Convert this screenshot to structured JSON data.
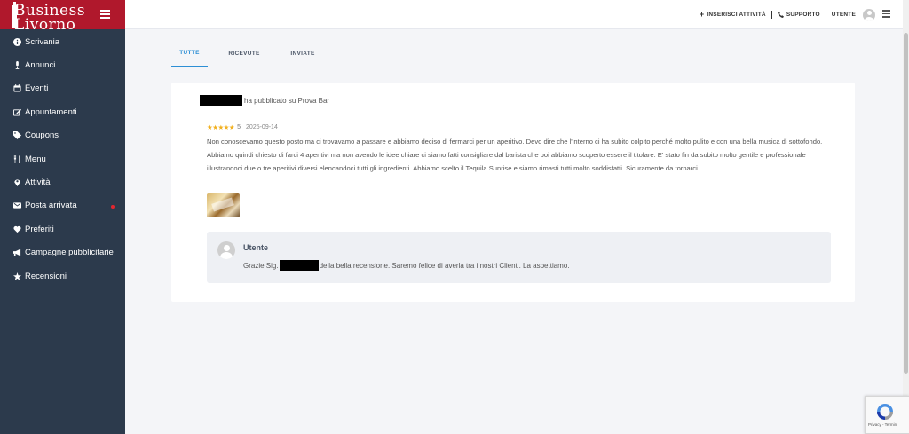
{
  "brand": {
    "line1": "Business",
    "line2": "Livorno"
  },
  "sidebar": {
    "items": [
      {
        "label": "Scrivania",
        "icon": "info-icon"
      },
      {
        "label": "Annunci",
        "icon": "microphone-icon"
      },
      {
        "label": "Eventi",
        "icon": "calendar-icon"
      },
      {
        "label": "Appuntamenti",
        "icon": "edit-icon"
      },
      {
        "label": "Coupons",
        "icon": "tags-icon"
      },
      {
        "label": "Menu",
        "icon": "utensils-icon"
      },
      {
        "label": "Attività",
        "icon": "map-marker-icon"
      },
      {
        "label": "Posta arrivata",
        "icon": "envelope-icon",
        "badge": true
      },
      {
        "label": "Preferiti",
        "icon": "heart-icon"
      },
      {
        "label": "Campagne pubblicitarie",
        "icon": "bullhorn-icon"
      },
      {
        "label": "Recensioni",
        "icon": "star-icon"
      }
    ]
  },
  "topbar": {
    "add_listing": "INSERISCI ATTIVITÀ",
    "support": "SUPPORTO",
    "user": "UTENTE"
  },
  "tabs": [
    {
      "label": "TUTTE",
      "active": true
    },
    {
      "label": "RICEVUTE",
      "active": false
    },
    {
      "label": "INVIATE",
      "active": false
    }
  ],
  "review": {
    "published_text": "ha pubblicato su Prova Bar",
    "stars": "★★★★★",
    "rating": "5",
    "date": "2025-09-14",
    "body": "Non conoscevamo questo posto ma ci trovavamo a passare e abbiamo deciso di fermarci per un aperitivo. Devo dire che l'interno ci ha subito colpito perché molto pulito e con una bella musica di sottofondo. Abbiamo quindi chiesto di farci 4 aperitivi ma non avendo le idee chiare ci siamo fatti consigliare dal barista che poi abbiamo scoperto essere il titolare. E' stato fin da subito molto gentile e professionale illustrandoci due o tre aperitivi diversi elencandoci tutti gli ingredienti. Abbiamo scelto il Tequila Sunrise e siamo rimasti tutti molto soddisfatti. Sicuramente da tornarci"
  },
  "reply": {
    "author": "Utente",
    "prefix": "Grazie Sig.",
    "suffix": "della bella recensione. Saremo felice di averla tra i nostri Clienti. La aspettiamo."
  },
  "recaptcha": {
    "text": "Privacy - Termini"
  },
  "colors": {
    "sidebar": "#2c3a4c",
    "brand": "#b0182c",
    "accent": "#2d8fd5",
    "star": "#f2b01e"
  }
}
